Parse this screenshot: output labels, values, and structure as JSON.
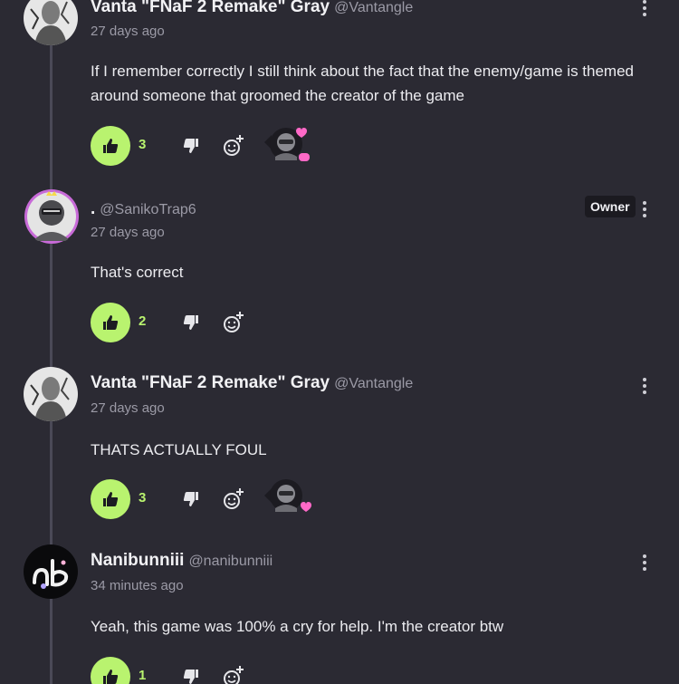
{
  "comments": [
    {
      "name": "Vanta \"FNaF 2 Remake\" Gray",
      "handle": "@Vantangle",
      "time": "27 days ago",
      "text": "If I remember correctly I still think about the fact that the enemy/game is themed around someone that groomed the creator of the game",
      "likes": "3",
      "badge": "",
      "avatar": "vanta-avatar",
      "reaction": "sanikotrap-reaction-with-heart-and-chat"
    },
    {
      "name": ".",
      "handle": "@SanikoTrap6",
      "time": "27 days ago",
      "text": "That's correct",
      "likes": "2",
      "badge": "Owner",
      "avatar": "sanikotrap-avatar",
      "reaction": ""
    },
    {
      "name": "Vanta \"FNaF 2 Remake\" Gray",
      "handle": "@Vantangle",
      "time": "27 days ago",
      "text": "THATS ACTUALLY FOUL",
      "likes": "3",
      "badge": "",
      "avatar": "vanta-avatar",
      "reaction": "sanikotrap-reaction-with-heart"
    },
    {
      "name": "Nanibunniii",
      "handle": "@nanibunniii",
      "time": "34 minutes ago",
      "text": "Yeah, this game was 100% a cry for help. I'm the creator btw",
      "likes": "1",
      "badge": "",
      "avatar": "nanibunniii-avatar",
      "reaction": ""
    }
  ],
  "colors": {
    "background": "#2b2a33",
    "like_accent": "#b9f36f",
    "heart_pink": "#ff69c8",
    "owner_ring": "#c86ad8"
  },
  "icons": {
    "more": "kebab-menu-icon",
    "like": "thumbs-up-icon",
    "dislike": "thumbs-down-icon",
    "react": "add-reaction-icon"
  }
}
